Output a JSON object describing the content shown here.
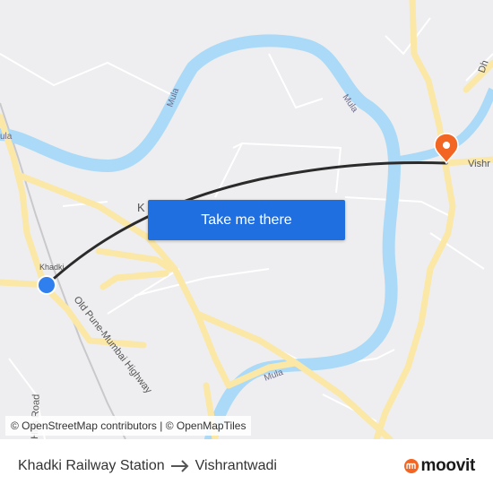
{
  "map": {
    "labels": {
      "river_mula_1": "Mula",
      "river_mula_2": "Mula",
      "river_mula_3": "Mula",
      "river_mula_left": "ula",
      "place_khadki": "Khadki",
      "place_k_partial": "K",
      "road_old_pune_mumbai": "Old Pune-Mumbai Highway",
      "road_hills": "Hills Road",
      "place_vishrantwadi_partial": "Vishr",
      "road_dh_partial": "Dh"
    },
    "colors": {
      "background": "#eeeef0",
      "river": "#aadaf7",
      "major_road": "#fbe7a6",
      "minor_road": "#ffffff",
      "route_line": "#2b2b2b",
      "origin_marker": "#2f7fef",
      "destination_marker": "#f26522"
    }
  },
  "cta": {
    "label": "Take me there"
  },
  "attribution": {
    "osm_maps": "© OpenStreetMap contributors",
    "separator": " | ",
    "osm_tiles": "© OpenMapTiles"
  },
  "footer": {
    "origin": "Khadki Railway Station",
    "destination": "Vishrantwadi",
    "arrow_icon": "arrow-right-icon"
  },
  "brand": {
    "name": "moovit",
    "icon": "moovit-logo-icon",
    "color": "#f26522"
  }
}
